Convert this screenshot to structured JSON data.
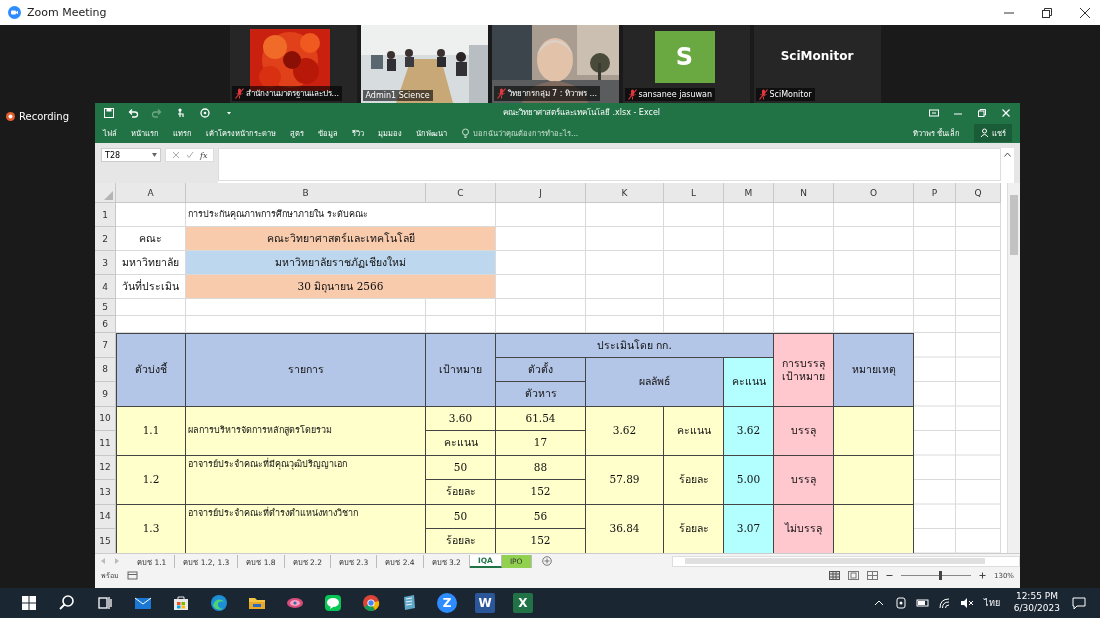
{
  "window": {
    "title": "Zoom Meeting"
  },
  "participants": [
    {
      "name": "สำนักงานมาตรฐานและปร...",
      "muted": true,
      "active_speaker": false
    },
    {
      "name": "Admin1 Science",
      "kind": "room",
      "muted": false,
      "active_speaker": true
    },
    {
      "name": "วิทยากรกลุ่ม 7 : ทิวาพร  ...",
      "kind": "person",
      "muted": true,
      "active_speaker": false
    },
    {
      "name": "sansanee jasuwan",
      "kind": "initial",
      "initial": "S",
      "muted": true,
      "active_speaker": false
    },
    {
      "name": "SciMonitor",
      "kind": "label",
      "label": "SciMonitor",
      "muted": true,
      "active_speaker": false
    }
  ],
  "recording": "Recording",
  "excel": {
    "title": "คณะวิทยาศาสตร์และเทคโนโลยี .xlsx - Excel",
    "ribbon_tabs": [
      "ไฟล์",
      "หน้าแรก",
      "แทรก",
      "เค้าโครงหน้ากระดาษ",
      "สูตร",
      "ข้อมูล",
      "รีวิว",
      "มุมมอง",
      "นักพัฒนา"
    ],
    "tell_me": "บอกฉันว่าคุณต้องการทำอะไร...",
    "user": "ทิวาพร ชั้นเล็ก",
    "share": "แชร์",
    "name_box": "T28",
    "function_label": "fx",
    "columns": [
      "A",
      "B",
      "C",
      "J",
      "K",
      "L",
      "M",
      "N",
      "O",
      "P",
      "Q"
    ],
    "rows": [
      "1",
      "2",
      "3",
      "4",
      "5",
      "6",
      "7",
      "8",
      "9",
      "10",
      "11",
      "12",
      "13",
      "14",
      "15"
    ],
    "cells": [
      {
        "text": "การประกันคุณภาพการศึกษาภายใน ระดับคณะ"
      },
      {
        "text": "คณะ"
      },
      {
        "text": "คณะวิทยาศาสตร์และเทคโนโลยี",
        "color": "#f8cbad"
      },
      {
        "text": "มหาวิทยาลัย"
      },
      {
        "text": "มหาวิทยาลัยราชภัฏเชียงใหม่",
        "color": "#bdd7ee"
      },
      {
        "text": "วันที่ประเมิน"
      },
      {
        "text": "30 มิถุนายน 2566",
        "color": "#f8cbad"
      },
      {
        "text": "ตัวบ่งชี้",
        "color": "#b4c6e7"
      },
      {
        "text": "รายการ",
        "color": "#b4c6e7"
      },
      {
        "text": "เป้าหมาย",
        "color": "#b4c6e7"
      },
      {
        "text": "ประเมินโดย กก.",
        "color": "#b4c6e7"
      },
      {
        "text": "ตัวตั้ง",
        "color": "#b4c6e7"
      },
      {
        "text": "ผลลัพธ์",
        "color": "#b4c6e7"
      },
      {
        "text": "คะแนน",
        "color": "#b3ffff"
      },
      {
        "text": "การบรรลุ\nเป้าหมาย",
        "color": "#ffc7ce"
      },
      {
        "text": "หมายเหตุ",
        "color": "#b4c6e7"
      },
      {
        "text": "ตัวหาร",
        "color": "#b4c6e7"
      },
      {
        "text": "1.1",
        "color": "#ffffcc"
      },
      {
        "text": "ผลการบริหารจัดการหลักสูตรโดยรวม",
        "color": "#ffffcc"
      },
      {
        "text": "3.60",
        "color": "#ffffcc"
      },
      {
        "text": "61.54",
        "color": "#ffffcc"
      },
      {
        "text": "3.62",
        "color": "#ffffcc"
      },
      {
        "text": "คะแนน",
        "color": "#ffffcc"
      },
      {
        "text": "3.62",
        "color": "#b3ffff"
      },
      {
        "text": "บรรลุ",
        "color": "#ffc7ce"
      },
      {
        "color": "#ffffcc"
      },
      {
        "text": "คะแนน",
        "color": "#ffffcc"
      },
      {
        "text": "17",
        "color": "#ffffcc"
      },
      {
        "text": "1.2",
        "color": "#ffffcc"
      },
      {
        "text": "อาจารย์ประจำคณะที่มีคุณวุฒิปริญญาเอก",
        "color": "#ffffcc"
      },
      {
        "text": "50",
        "color": "#ffffcc"
      },
      {
        "text": "88",
        "color": "#ffffcc"
      },
      {
        "text": "57.89",
        "color": "#ffffcc"
      },
      {
        "text": "ร้อยละ",
        "color": "#ffffcc"
      },
      {
        "text": "5.00",
        "color": "#b3ffff"
      },
      {
        "text": "บรรลุ",
        "color": "#ffc7ce"
      },
      {
        "color": "#ffffcc"
      },
      {
        "text": "ร้อยละ",
        "color": "#ffffcc"
      },
      {
        "text": "152",
        "color": "#ffffcc"
      },
      {
        "text": "1.3",
        "color": "#ffffcc"
      },
      {
        "text": "อาจารย์ประจำคณะที่ดำรงตำแหน่งทางวิชาก",
        "color": "#ffffcc"
      },
      {
        "text": "50",
        "color": "#ffffcc"
      },
      {
        "text": "56",
        "color": "#ffffcc"
      },
      {
        "text": "36.84",
        "color": "#ffffcc"
      },
      {
        "text": "ร้อยละ",
        "color": "#ffffcc"
      },
      {
        "text": "3.07",
        "color": "#b3ffff"
      },
      {
        "text": "ไม่บรรลุ",
        "color": "#ffc7ce"
      },
      {
        "color": "#ffffcc"
      },
      {
        "text": "ร้อยละ",
        "color": "#ffffcc"
      },
      {
        "text": "152",
        "color": "#ffffcc"
      }
    ],
    "sheet_tabs": [
      {
        "label": "คบช 1.1",
        "selected": false
      },
      {
        "label": "คบช 1.2, 1.3",
        "selected": false
      },
      {
        "label": "คบช 1.8",
        "selected": false
      },
      {
        "label": "คบช 2.2",
        "selected": false
      },
      {
        "label": "คบช 2.3",
        "selected": false
      },
      {
        "label": "คบช 2.4",
        "selected": false
      },
      {
        "label": "คบช 3.2",
        "selected": false
      },
      {
        "label": "IQA",
        "selected": true
      },
      {
        "label": "IPO",
        "selected": false,
        "color": "#92d050"
      }
    ],
    "status": "พร้อม",
    "zoom": {
      "level": 0.55,
      "reading": "130%"
    }
  },
  "taskbar": {
    "apps": [
      {
        "kind": "start"
      },
      {
        "kind": "search"
      },
      {
        "kind": "taskview"
      },
      {
        "kind": "mail"
      },
      {
        "kind": "store"
      },
      {
        "kind": "edge"
      },
      {
        "kind": "folder"
      },
      {
        "kind": "swirl"
      },
      {
        "kind": "chat"
      },
      {
        "kind": "chrome"
      },
      {
        "kind": "notes"
      },
      {
        "kind": "zoom",
        "glyph": "Z"
      },
      {
        "kind": "word",
        "glyph": "W"
      },
      {
        "kind": "excel",
        "glyph": "X"
      }
    ],
    "language": "ไทย",
    "time": "12:55 PM",
    "date": "6/30/2023"
  }
}
